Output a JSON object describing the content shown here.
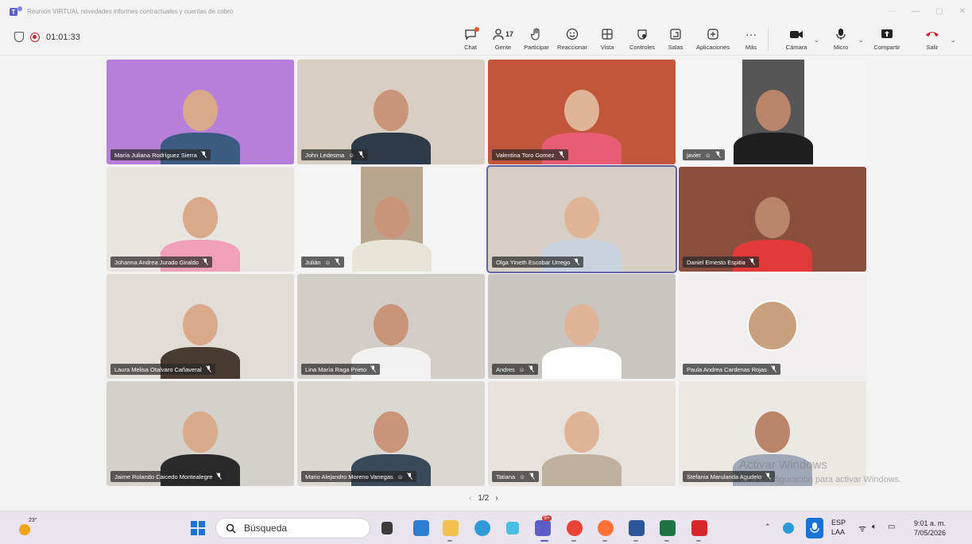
{
  "window": {
    "title": "Reunión VIRTUAL novedades informes contractuales y cuentas de cobro",
    "controls": [
      "···",
      "—",
      "▢",
      "✕"
    ]
  },
  "meeting": {
    "timer": "01:01:33",
    "toolbar": {
      "chat": "Chat",
      "people": "Gente",
      "people_count": "17",
      "raise": "Participar",
      "react": "Reaccionar",
      "view": "Vista",
      "controls": "Controles",
      "rooms": "Salas",
      "apps": "Aplicaciones",
      "more": "Más",
      "camera": "Cámara",
      "mic": "Micro",
      "share": "Compartir",
      "leave": "Salir"
    },
    "pager": {
      "prev": "‹",
      "current": "1/2",
      "next": "›"
    },
    "participants": [
      {
        "name": "María Juliana Rodríguez Sierra",
        "bg": "#b77fd9"
      },
      {
        "name": "John Ledesma",
        "bg": "#d8cfc2"
      },
      {
        "name": "Valentina Toro Gomez",
        "bg": "#c2563a"
      },
      {
        "name": "javier",
        "bg": "#3a3a3a"
      },
      {
        "name": "Johanna Andrea Jurado Giraldo",
        "bg": "#e8e4e0"
      },
      {
        "name": "Julián",
        "bg": "#a9927a"
      },
      {
        "name": "Olga Yineth Escobar Urrego",
        "bg": "#d7cfc6"
      },
      {
        "name": "Daniel Ernesto Espitia",
        "bg": "#8a4e3e"
      },
      {
        "name": "Laura Melisa Otalvaro Cañaveral",
        "bg": "#e2dcd7"
      },
      {
        "name": "Lina María Raga Prieto",
        "bg": "#d3cdc7"
      },
      {
        "name": "Andres",
        "bg": "#c9c6c1"
      },
      {
        "name": "Paula Andrea Cardenas Rojas",
        "bg": "#f0eeee"
      },
      {
        "name": "Jaime Rolando Caicedo Montealegre",
        "bg": "#d4d0cb"
      },
      {
        "name": "Mario Alejandro Moreno Vanegas",
        "bg": "#dbd8d4"
      },
      {
        "name": "Tatiana",
        "bg": "#e7e2dc"
      },
      {
        "name": "Stefania Marulanda Agudelo",
        "bg": "#ece8e4"
      }
    ]
  },
  "watermark": {
    "line1": "Activar Windows",
    "line2": "Ve a Configuración para activar Windows."
  },
  "taskbar": {
    "temp": "23°",
    "search_placeholder": "Búsqueda",
    "lang1": "ESP",
    "lang2": "LAA",
    "time": "9:01 a. m.",
    "date": "7/05/2026",
    "teams_badge": "9+"
  }
}
